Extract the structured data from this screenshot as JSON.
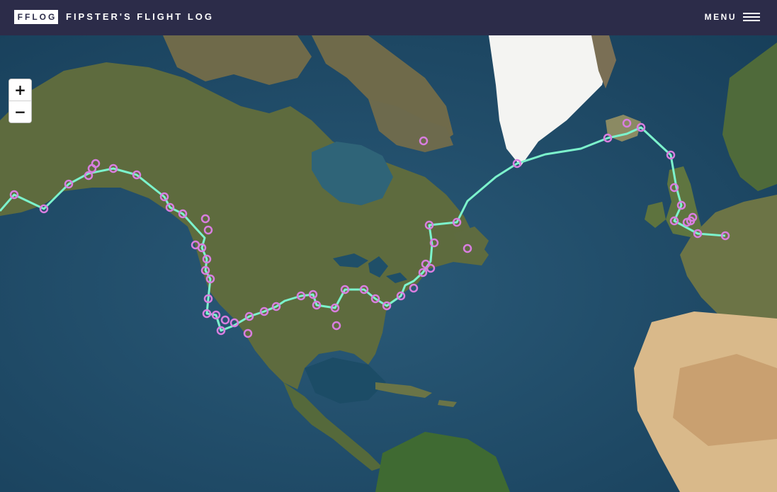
{
  "header": {
    "logo_text": "FFLOG",
    "title": "FIPSTER'S FLIGHT LOG",
    "menu_label": "MENU",
    "menu_icon": "hamburger-icon"
  },
  "map_controls": {
    "zoom_in_label": "+",
    "zoom_out_label": "−"
  },
  "map_style": {
    "route_color": "#7cf3cc",
    "marker_color": "#d97ee0",
    "ocean_color": "#1d4a66",
    "land_color": "#5d6a3f",
    "ice_color": "#f4f4f2"
  }
}
